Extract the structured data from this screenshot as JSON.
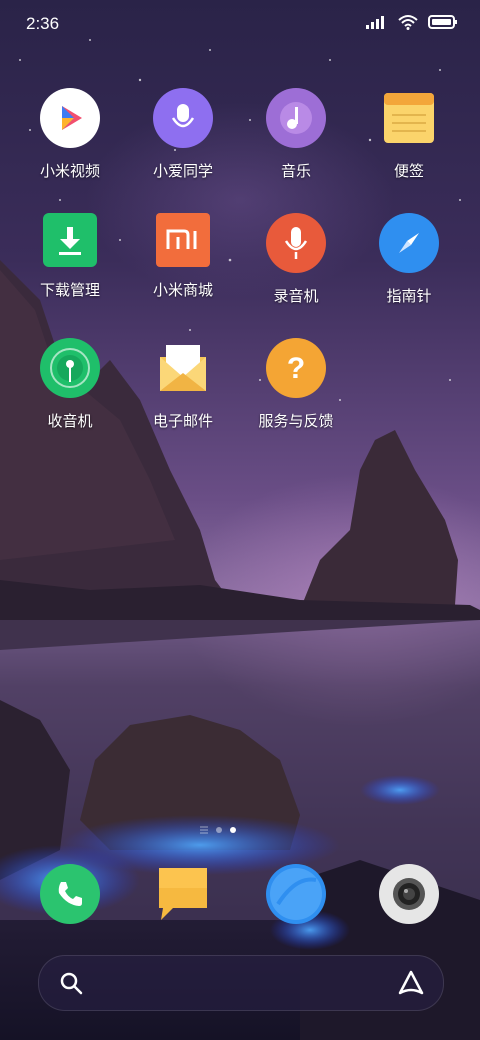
{
  "status_bar": {
    "time": "2:36",
    "signal_icon": "signal-bars-icon",
    "wifi_icon": "wifi-icon",
    "battery_icon": "battery-icon"
  },
  "apps": [
    {
      "label": "小米视频",
      "icon": "video-play-icon",
      "color": "#ffffff"
    },
    {
      "label": "小爱同学",
      "icon": "mic-assistant-icon",
      "color": "#8e6ff0"
    },
    {
      "label": "音乐",
      "icon": "music-note-icon",
      "color": "#9d6ed6"
    },
    {
      "label": "便签",
      "icon": "notes-icon",
      "color": "#f4b63f"
    },
    {
      "label": "下载管理",
      "icon": "download-icon",
      "color": "#1fbf6a"
    },
    {
      "label": "小米商城",
      "icon": "mi-store-icon",
      "color": "#f26d3c"
    },
    {
      "label": "录音机",
      "icon": "microphone-icon",
      "color": "#e85a3b"
    },
    {
      "label": "指南针",
      "icon": "compass-icon",
      "color": "#2f8ff0"
    },
    {
      "label": "收音机",
      "icon": "radio-icon",
      "color": "#1fbf6a"
    },
    {
      "label": "电子邮件",
      "icon": "mail-icon",
      "color": "#f6c85a"
    },
    {
      "label": "服务与反馈",
      "icon": "help-icon",
      "color": "#f4a534"
    }
  ],
  "dock": [
    {
      "icon": "phone-icon",
      "color": "#2bc46f"
    },
    {
      "icon": "messages-icon",
      "color": "#f6b940"
    },
    {
      "icon": "browser-icon",
      "color": "#2f8ff0"
    },
    {
      "icon": "camera-icon",
      "color": "#e6e6e6"
    }
  ],
  "search": {
    "left_icon": "search-icon",
    "right_icon": "assistant-icon"
  },
  "pages": {
    "count": 3,
    "active": 3
  }
}
